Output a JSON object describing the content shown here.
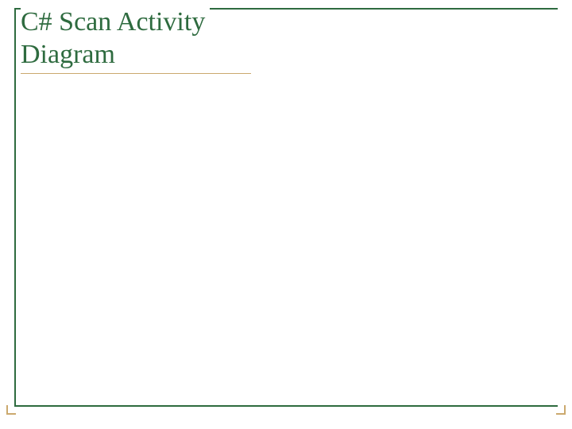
{
  "slide": {
    "title_line1": "C# Scan Activity",
    "title_line2": "Diagram"
  }
}
